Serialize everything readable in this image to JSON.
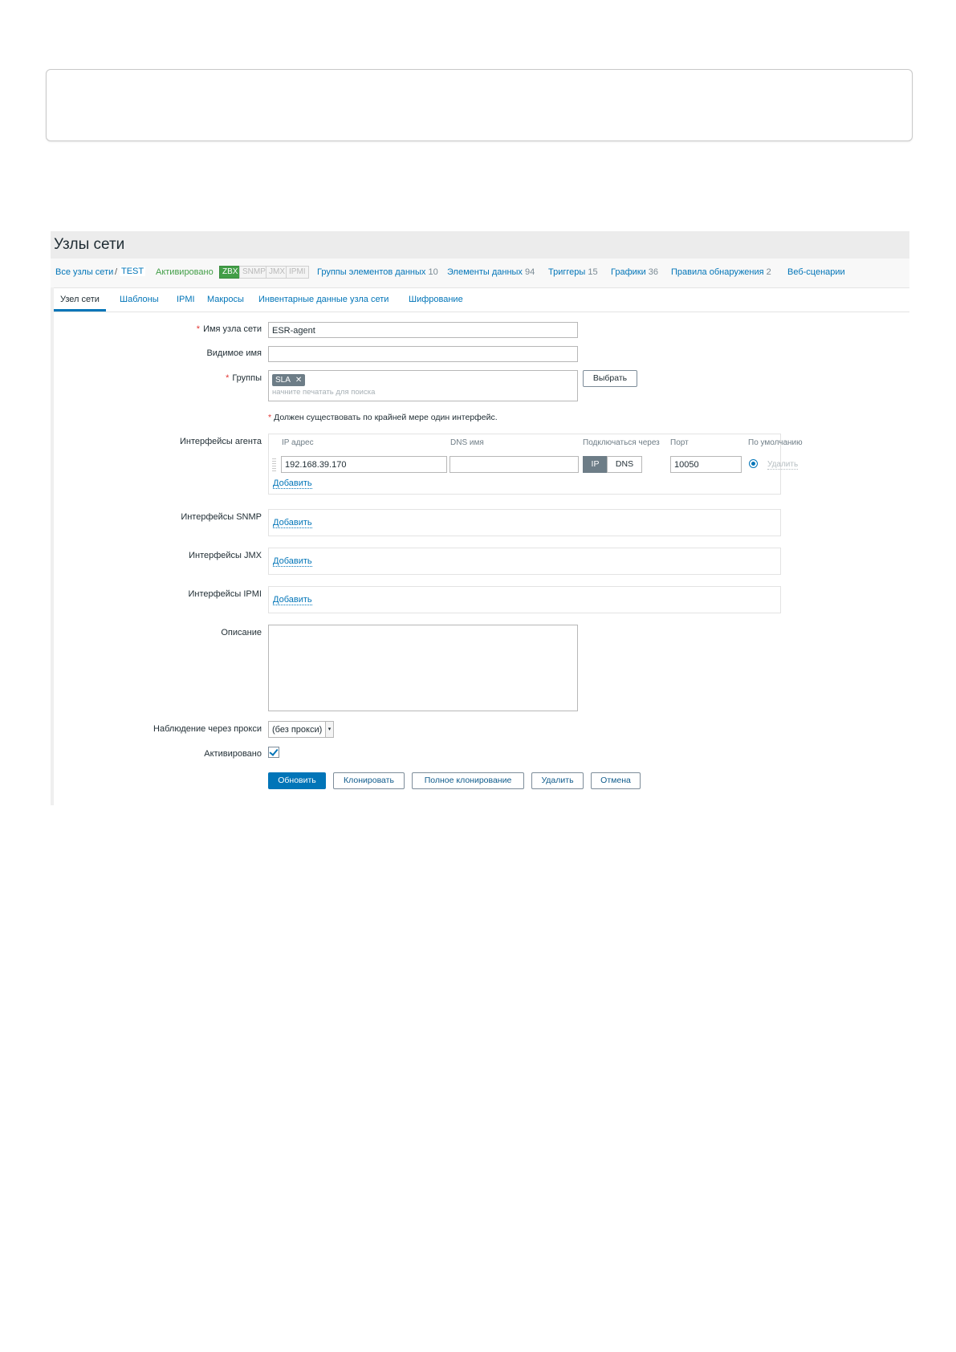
{
  "page": {
    "title": "Узлы сети"
  },
  "breadcrumbs": {
    "all_hosts": "Все узлы сети",
    "separator": "/",
    "current": "TEST",
    "status": "Активировано",
    "availability": [
      "ZBX",
      "SNMP",
      "JMX",
      "IPMI"
    ],
    "links": [
      {
        "label": "Группы элементов данных",
        "count": "10"
      },
      {
        "label": "Элементы данных",
        "count": "94"
      },
      {
        "label": "Триггеры",
        "count": "15"
      },
      {
        "label": "Графики",
        "count": "36"
      },
      {
        "label": "Правила обнаружения",
        "count": "2"
      },
      {
        "label": "Веб-сценарии",
        "count": ""
      }
    ]
  },
  "tabs": [
    "Узел сети",
    "Шаблоны",
    "IPMI",
    "Макросы",
    "Инвентарные данные узла сети",
    "Шифрование"
  ],
  "form": {
    "host_name": {
      "required": "*",
      "label": "Имя узла сети",
      "value": "ESR-agent"
    },
    "visible_name": {
      "label": "Видимое имя",
      "value": ""
    },
    "groups": {
      "required": "*",
      "label": "Группы",
      "chip": "SLA",
      "chip_remove": "✕",
      "placeholder": "начните печатать для поиска",
      "select_button": "Выбрать"
    },
    "interface_note": {
      "required": "*",
      "text": "Должен существовать по крайней мере один интерфейс."
    },
    "agent_interfaces": {
      "label": "Интерфейсы агента",
      "headers": {
        "ip": "IP адрес",
        "dns": "DNS имя",
        "connect": "Подключаться через",
        "port": "Порт",
        "default": "По умолчанию"
      },
      "ip": "192.168.39.170",
      "dns": "",
      "connect_options": [
        "IP",
        "DNS"
      ],
      "connect_selected": "IP",
      "port": "10050",
      "remove": "Удалить",
      "add": "Добавить"
    },
    "snmp_interfaces": {
      "label": "Интерфейсы SNMP",
      "add": "Добавить"
    },
    "jmx_interfaces": {
      "label": "Интерфейсы JMX",
      "add": "Добавить"
    },
    "ipmi_interfaces": {
      "label": "Интерфейсы IPMI",
      "add": "Добавить"
    },
    "description": {
      "label": "Описание",
      "value": ""
    },
    "proxy": {
      "label": "Наблюдение через прокси",
      "value": "(без прокси)"
    },
    "enabled": {
      "label": "Активировано",
      "checked": true
    }
  },
  "buttons": {
    "update": "Обновить",
    "clone": "Клонировать",
    "full_clone": "Полное клонирование",
    "delete": "Удалить",
    "cancel": "Отмена"
  },
  "colors": {
    "accent": "#0275b8",
    "green": "#429e47",
    "required": "#e33734"
  }
}
